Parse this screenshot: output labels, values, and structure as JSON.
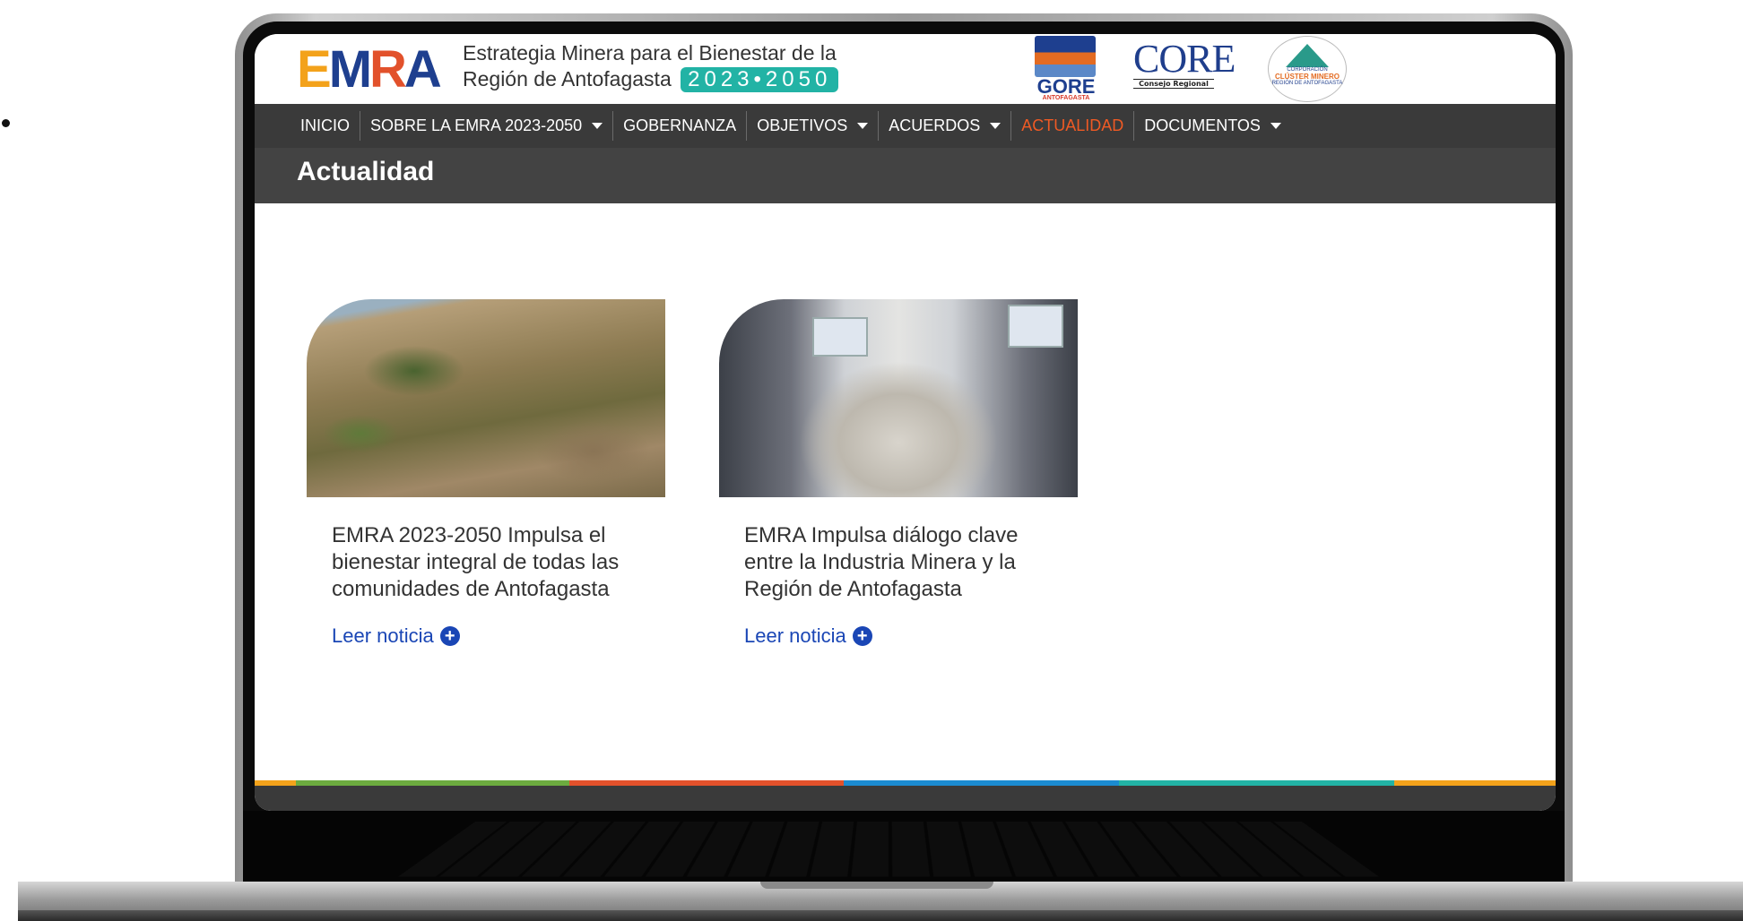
{
  "brand": {
    "logo_letters": [
      "E",
      "M",
      "R",
      "A"
    ],
    "logo_colors": [
      "#f3a21b",
      "#1e3f8f",
      "#e2512b",
      "#1e3f8f"
    ],
    "tagline_line1": "Estrategia Minera para el Bienestar de la",
    "tagline_line2": "Región de Antofagasta",
    "years": "2023•2050",
    "years_color": "#22b3a5"
  },
  "partners": {
    "gore": "GORE",
    "gore_sub": "ANTOFAGASTA",
    "core": "CORE",
    "core_sub": "Consejo Regional",
    "cluster_top": "CORPORACIÓN",
    "cluster_main": "CLÚSTER MINERO",
    "cluster_sub": "REGIÓN DE ANTOFAGASTA"
  },
  "nav": {
    "items": [
      {
        "label": "INICIO"
      },
      {
        "label": "SOBRE LA EMRA 2023-2050"
      },
      {
        "label": "GOBERNANZA"
      },
      {
        "label": "OBJETIVOS"
      },
      {
        "label": "ACUERDOS"
      },
      {
        "label": "ACTUALIDAD"
      },
      {
        "label": "DOCUMENTOS"
      }
    ],
    "active_color": "#ef5a24"
  },
  "page": {
    "title": "Actualidad"
  },
  "news": [
    {
      "title": "EMRA 2023-2050 Impulsa el bienestar integral de todas las comunidades de Antofagasta",
      "link": "Leer noticia"
    },
    {
      "title": "EMRA Impulsa diálogo clave entre la Industria Minera y la Región de Antofagasta",
      "link": "Leer noticia"
    }
  ],
  "footer_stripe_colors": [
    "#f3a21b",
    "#6cab3f",
    "#e2512b",
    "#1b8bd1",
    "#22b3a5",
    "#f3a21b"
  ]
}
